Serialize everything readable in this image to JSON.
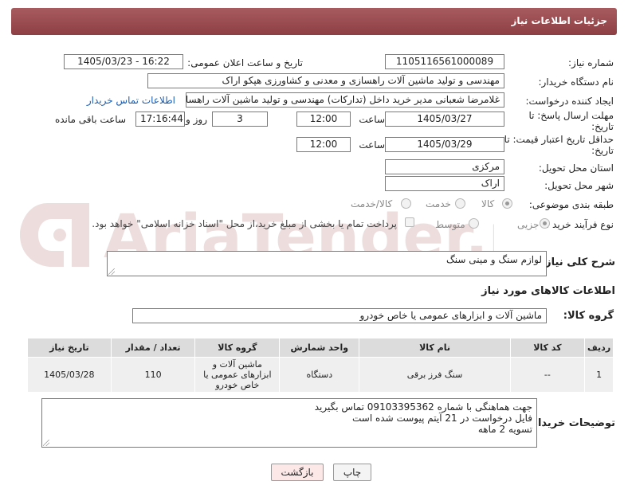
{
  "header": {
    "title": "جزئیات اطلاعات نیاز"
  },
  "fields": {
    "need_number_label": "شماره نیاز:",
    "need_number": "1105116561000089",
    "announce_label": "تاریخ و ساعت اعلان عمومی:",
    "announce_value": "1405/03/23 - 16:22",
    "buyer_org_label": "نام دستگاه خریدار:",
    "buyer_org": "مهندسی و تولید ماشین آلات راهسازی و معدنی و کشاورزی هپکو اراک",
    "requester_label": "ایجاد کننده درخواست:",
    "requester": "غلامرضا شعبانی مدیر خرید داخل (تدارکات) مهندسی و تولید ماشین آلات راهسا",
    "contact_link": "اطلاعات تماس خریدار",
    "deadline_label": "مهلت ارسال پاسخ: تا تاریخ:",
    "deadline_date": "1405/03/27",
    "time_label": "ساعت",
    "deadline_time": "12:00",
    "days_value": "3",
    "days_label": "روز و",
    "remaining_time": "17:16:44",
    "remaining_label": "ساعت باقی مانده",
    "price_validity_label": "حداقل تاریخ اعتبار قیمت: تا تاریخ:",
    "price_date": "1405/03/29",
    "price_time": "12:00",
    "province_label": "استان محل تحویل:",
    "province": "مرکزی",
    "city_label": "شهر محل تحویل:",
    "city": "اراک",
    "category_label": "طبقه بندی موضوعی:",
    "category_options": [
      "کالا",
      "خدمت",
      "کالا/خدمت"
    ],
    "process_label": "نوع فرآیند خرید :",
    "process_options": [
      "جزیی",
      "متوسط"
    ],
    "payment_note": "پرداخت تمام یا بخشی از مبلغ خرید،از محل \"اسناد خزانه اسلامی\" خواهد بود."
  },
  "description": {
    "label": "شرح کلی نیاز:",
    "text": "لوازم سنگ و مینی سنگ"
  },
  "goods": {
    "section_title": "اطلاعات کالاهای مورد نیاز",
    "group_label": "گروه کالا:",
    "group_value": "ماشین آلات و ابزارهای عمومی یا خاص خودرو",
    "columns": [
      "ردیف",
      "کد کالا",
      "نام کالا",
      "واحد شمارش",
      "گروه کالا",
      "تعداد / مقدار",
      "تاریخ نیاز"
    ],
    "rows": [
      {
        "index": "1",
        "code": "--",
        "name": "سنگ فرز برقی",
        "unit": "دستگاه",
        "group": "ماشین آلات و ابزارهای عمومی یا خاص خودرو",
        "qty": "110",
        "date": "1405/03/28"
      }
    ]
  },
  "buyer_notes": {
    "label": "توضیحات خریدار:",
    "line1": "جهت هماهنگی با شماره 09103395362 تماس بگیرید",
    "line2": "فایل درخواست در 21 آیتم پیوست شده است",
    "line3": "تسویه 2 ماهه"
  },
  "buttons": {
    "print": "چاپ",
    "back": "بازگشت"
  },
  "watermark": {
    "text": "AriaTender.neT"
  },
  "colors": {
    "header": "#9a4a4f",
    "link": "#1a5fb4",
    "back_button": "#fde8e8"
  }
}
